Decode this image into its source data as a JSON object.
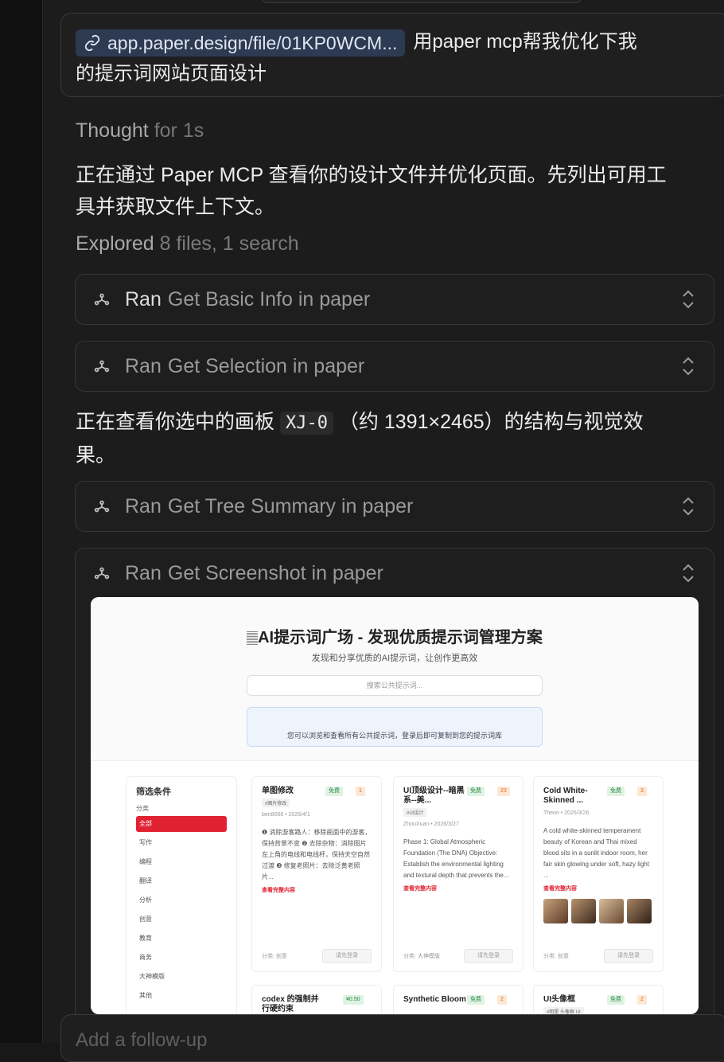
{
  "prompt": {
    "link_chip": "app.paper.design/file/01KP0WCM...",
    "message_line1": "用paper mcp帮我优化下我",
    "message_line2": "的提示词网站页面设计"
  },
  "thought": {
    "label": "Thought",
    "duration": "for 1s"
  },
  "para1": {
    "line1": "正在通过 Paper MCP 查看你的设计文件并优化页面。先列出可用工",
    "line2": "具并获取文件上下文。"
  },
  "explored": {
    "label": "Explored",
    "detail": "8 files, 1 search"
  },
  "tools": [
    {
      "ran": "Ran",
      "name": "Get Basic Info in paper"
    },
    {
      "ran": "Ran",
      "name": "Get Selection in paper"
    },
    {
      "ran": "Ran",
      "name": "Get Tree Summary in paper"
    },
    {
      "ran": "Ran",
      "name": "Get Screenshot in paper"
    }
  ],
  "para2": {
    "before": "正在查看你选中的画板",
    "code": "XJ-0",
    "after": "（约 1391×2465）的结构与视觉效",
    "line2": "果。"
  },
  "screenshot": {
    "title": "AI提示词广场 - 发现优质提示词管理方案",
    "subtitle": "发现和分享优质的AI提示词，让创作更高效",
    "search_placeholder": "搜索公共提示词...",
    "notice": "您可以浏览和查看所有公共提示词，登录后即可复制到您的提示词库",
    "filter": {
      "title": "筛选条件",
      "section": "分类",
      "items": [
        "全部",
        "写作",
        "编程",
        "翻译",
        "分析",
        "创意",
        "教育",
        "商务",
        "大神模版",
        "其他"
      ]
    },
    "cards": [
      {
        "title": "单图修改",
        "free": "免费",
        "count": "1",
        "tag": "#图片修改",
        "author": "ben8066",
        "date": "2026/4/1",
        "body": "❶ 消除游客路人：移除画面中的游客，保持背景不变 ❷ 去除杂物：消除图片左上角的电线和电线杆，保持天空自然过渡 ❸ 修复老照片：去除泛黄老照片...",
        "more": "查看完整内容",
        "category": "分类: 创意",
        "login": "请先登录"
      },
      {
        "title": "UI顶级设计--暗黑系--美...",
        "free": "免费",
        "count": "23",
        "tag": "#UI设计",
        "author": "ZhouXuan",
        "date": "2026/3/27",
        "body": "Phase 1: Global Atmospheric Foundation (The DNA) Objective: Establish the environmental lighting and textural depth that prevents the...",
        "more": "查看完整内容",
        "category": "分类: 大神模版",
        "login": "请先登录"
      },
      {
        "title": "Cold White-Skinned ...",
        "free": "免费",
        "count": "3",
        "tag": "",
        "author": "Theon",
        "date": "2026/3/26",
        "body": "A cold white-skinned temperament beauty of Korean and Thai mixed blood sits in a sunlit indoor room, her fair skin glowing under soft, hazy light ...",
        "more": "查看完整内容",
        "category": "分类: 创意",
        "login": "请先登录"
      },
      {
        "title": "codex 的强制并行硬约束",
        "free": "¥0.50",
        "count": ""
      },
      {
        "title": "Synthetic Bloom",
        "free": "免费",
        "count": "2"
      },
      {
        "title": "UI头像框",
        "free": "免费",
        "count": "2",
        "tag": "#明星  头像框  UI"
      }
    ]
  },
  "followup_placeholder": "Add a follow-up"
}
